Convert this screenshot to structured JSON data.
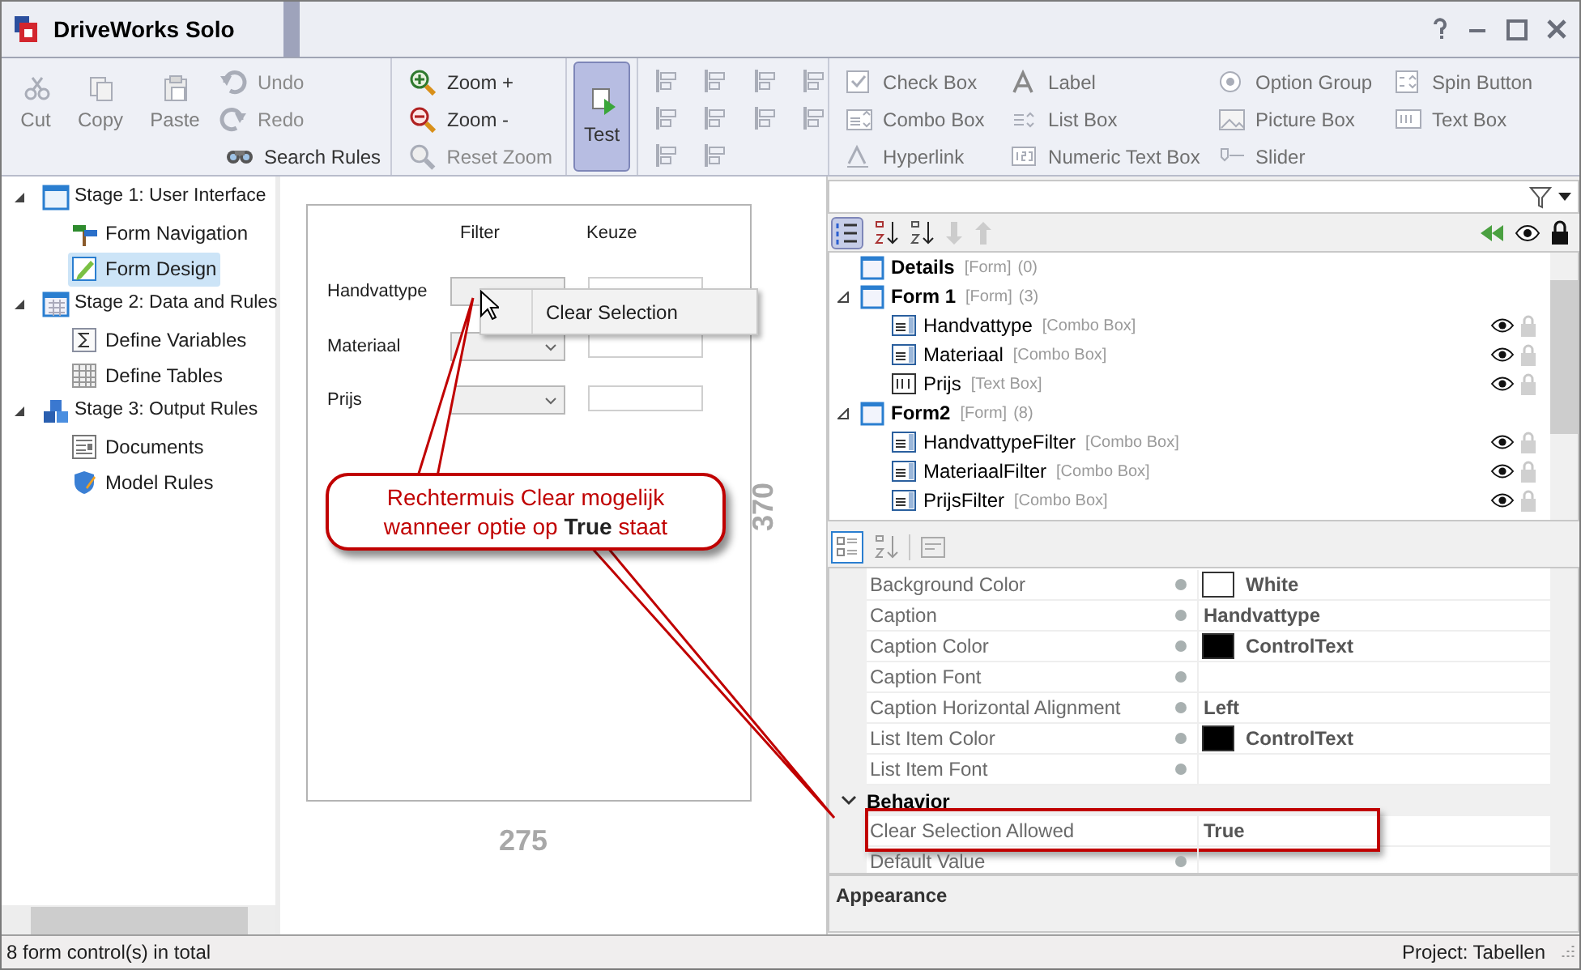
{
  "window": {
    "title": "DriveWorks Solo"
  },
  "ribbon": {
    "edit": [
      {
        "label": "Cut",
        "disabled": true
      },
      {
        "label": "Copy",
        "disabled": true
      },
      {
        "label": "Paste",
        "disabled": true
      }
    ],
    "history": [
      {
        "label": "Undo",
        "disabled": true
      },
      {
        "label": "Redo",
        "disabled": true
      },
      {
        "label": "Search Rules",
        "disabled": false
      }
    ],
    "zoom": [
      {
        "label": "Zoom +",
        "disabled": false
      },
      {
        "label": "Zoom -",
        "disabled": false
      },
      {
        "label": "Reset Zoom",
        "disabled": true
      }
    ],
    "test": {
      "label": "Test",
      "selected": true
    },
    "controls": [
      {
        "label": "Check Box",
        "disabled": true
      },
      {
        "label": "Label",
        "disabled": true
      },
      {
        "label": "Option Group",
        "disabled": true
      },
      {
        "label": "Spin Button",
        "disabled": true
      },
      {
        "label": "Combo Box",
        "disabled": true
      },
      {
        "label": "List Box",
        "disabled": true
      },
      {
        "label": "Picture Box",
        "disabled": true
      },
      {
        "label": "Text Box",
        "disabled": true
      },
      {
        "label": "Hyperlink",
        "disabled": true
      },
      {
        "label": "Numeric Text Box",
        "disabled": true
      },
      {
        "label": "Slider",
        "disabled": true
      }
    ]
  },
  "navigation": [
    {
      "label": "Stage 1: User Interface",
      "expanded": true,
      "selected": false,
      "children": [
        {
          "label": "Form Navigation",
          "selected": false
        },
        {
          "label": "Form Design",
          "selected": true
        }
      ]
    },
    {
      "label": "Stage 2: Data and Rules",
      "expanded": true,
      "selected": false,
      "children": [
        {
          "label": "Define Variables",
          "selected": false
        },
        {
          "label": "Define Tables",
          "selected": false
        }
      ]
    },
    {
      "label": "Stage 3: Output Rules",
      "expanded": true,
      "selected": false,
      "children": [
        {
          "label": "Documents",
          "selected": false
        },
        {
          "label": "Model Rules",
          "selected": false
        }
      ]
    }
  ],
  "designer": {
    "columns": [
      "Filter",
      "Keuze"
    ],
    "rows": [
      {
        "label": "Handvattype"
      },
      {
        "label": "Materiaal"
      },
      {
        "label": "Prijs"
      }
    ],
    "context_menu": [
      "Clear Selection"
    ],
    "height_dimension": "370",
    "width_dimension": "275",
    "callout": "Rechtermuis Clear mogelijk wanneer optie op **True** staat"
  },
  "controls_tree": [
    {
      "kind": "form",
      "name": "Details",
      "type": "[Form]",
      "count": "(0)"
    },
    {
      "kind": "form",
      "name": "Form 1",
      "type": "[Form]",
      "count": "(3)",
      "expanded": true,
      "children": [
        {
          "kind": "combo",
          "name": "Handvattype",
          "type": "[Combo Box]",
          "visible": true,
          "locked": false
        },
        {
          "kind": "combo",
          "name": "Materiaal",
          "type": "[Combo Box]",
          "visible": true,
          "locked": false
        },
        {
          "kind": "text",
          "name": "Prijs",
          "type": "[Text Box]",
          "visible": true,
          "locked": false
        }
      ]
    },
    {
      "kind": "form",
      "name": "Form2",
      "type": "[Form]",
      "count": "(8)",
      "expanded": true,
      "children": [
        {
          "kind": "combo",
          "name": "HandvattypeFilter",
          "type": "[Combo Box]",
          "visible": true,
          "locked": false
        },
        {
          "kind": "combo",
          "name": "MateriaalFilter",
          "type": "[Combo Box]",
          "visible": true,
          "locked": false
        },
        {
          "kind": "combo",
          "name": "PrijsFilter",
          "type": "[Combo Box]",
          "visible": true,
          "locked": false
        }
      ]
    }
  ],
  "properties": [
    {
      "kind": "property",
      "name": "Background Color",
      "value": "White",
      "color": "#ffffff",
      "default_marker": true,
      "highlighted": false
    },
    {
      "kind": "property",
      "name": "Caption",
      "value": "Handvattype",
      "default_marker": true,
      "highlighted": false
    },
    {
      "kind": "property",
      "name": "Caption Color",
      "value": "ControlText",
      "color": "#000000",
      "default_marker": true,
      "highlighted": false
    },
    {
      "kind": "property",
      "name": "Caption Font",
      "default_marker": true,
      "highlighted": false
    },
    {
      "kind": "property",
      "name": "Caption Horizontal Alignment",
      "value": "Left",
      "default_marker": true,
      "highlighted": false
    },
    {
      "kind": "property",
      "name": "List Item Color",
      "value": "ControlText",
      "color": "#000000",
      "default_marker": true,
      "highlighted": false
    },
    {
      "kind": "property",
      "name": "List Item Font",
      "default_marker": true,
      "highlighted": false
    },
    {
      "kind": "category",
      "name": "Behavior",
      "expanded": true
    },
    {
      "kind": "property",
      "name": "Clear Selection Allowed",
      "value": "True",
      "default_marker": false,
      "highlighted": true
    },
    {
      "kind": "property",
      "name": "Default Value",
      "default_marker": true,
      "highlighted": false
    }
  ],
  "description": {
    "title": "Appearance"
  },
  "status_bar": {
    "left": "8 form control(s) in total",
    "right": "Project: Tabellen"
  }
}
